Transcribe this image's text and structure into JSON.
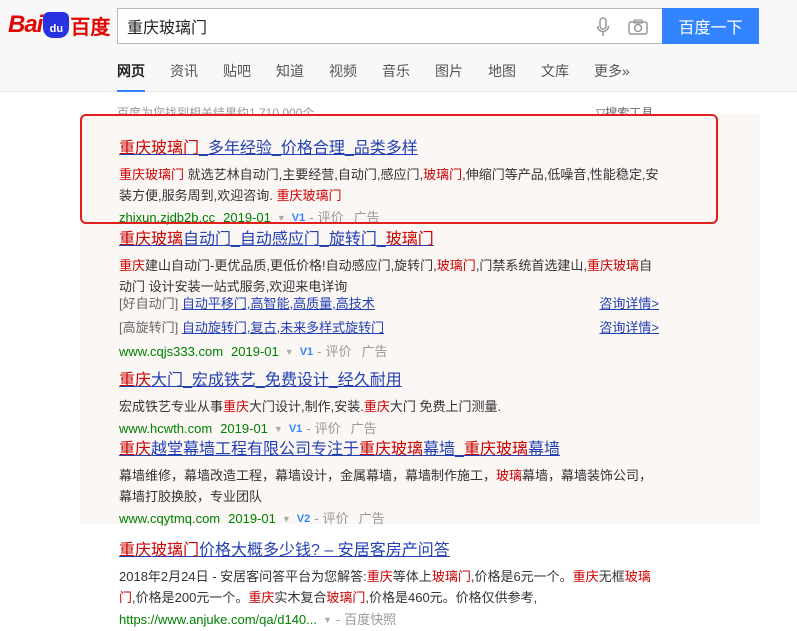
{
  "logo": {
    "bai": "Bai",
    "du": "du",
    "cn": "百度"
  },
  "search": {
    "query": "重庆玻璃门",
    "button": "百度一下"
  },
  "tabs": [
    "网页",
    "资讯",
    "贴吧",
    "知道",
    "视频",
    "音乐",
    "图片",
    "地图",
    "文库",
    "更多»"
  ],
  "result_count": "百度为您找到相关结果约1,710,000个",
  "tools": "搜索工具",
  "results": [
    {
      "title_parts": [
        "重庆玻璃门",
        "_多年经验_价格合理_品类多样"
      ],
      "desc_parts": [
        "重庆玻璃门",
        " 就选艺林自动门,主要经营,自动门,感应门,",
        "玻璃门",
        ",伸缩门等产品,低噪音,性能稳定,安装方便,服务周到,欢迎咨询. ",
        "重庆玻璃门"
      ],
      "url": "zhixun.zjdb2b.cc",
      "date": "2019-01",
      "badge": "V1",
      "eval": "评价",
      "ad": "广告"
    },
    {
      "title_parts": [
        "重庆玻璃",
        "自动门_自动感应门_旋转门_",
        "玻璃门"
      ],
      "desc_parts": [
        "重庆",
        "建山自动门-更优品质,更低价格!自动感应门,旋转门,",
        "玻璃门",
        ",门禁系统首选建山,",
        "重庆玻璃",
        "自动门 设计安装一站式服务,欢迎来电详询"
      ],
      "sub": [
        {
          "cat": "[好自动门]",
          "links": "自动平移门,高智能,高质量,高技术",
          "detail": "咨询详情>"
        },
        {
          "cat": "[高旋转门]",
          "links": "自动旋转门,复古,未来多样式旋转门",
          "detail": "咨询详情>"
        }
      ],
      "url": "www.cqjs333.com",
      "date": "2019-01",
      "badge": "V1",
      "eval": "评价",
      "ad": "广告"
    },
    {
      "title_parts": [
        "重庆",
        "大门_宏成铁艺_免费设计_经久耐用"
      ],
      "desc_parts": [
        "宏成铁艺专业从事",
        "重庆",
        "大门设计,制作,安装.",
        "重庆",
        "大门 免费上门测量."
      ],
      "url": "www.hcwth.com",
      "date": "2019-01",
      "badge": "V1",
      "eval": "评价",
      "ad": "广告"
    },
    {
      "title_parts": [
        "重庆",
        "越堂幕墙工程有限公司专注于",
        "重庆玻璃",
        "幕墙_",
        "重庆玻璃",
        "幕墙"
      ],
      "desc_parts": [
        "幕墙维修，幕墙改造工程，幕墙设计，金属幕墙，幕墙制作施工，",
        "玻璃",
        "幕墙，幕墙装饰公司，幕墙打胶换胶，专业团队"
      ],
      "url": "www.cqytmq.com",
      "date": "2019-01",
      "badge": "V2",
      "eval": "评价",
      "ad": "广告"
    },
    {
      "title_parts": [
        "重庆玻璃门",
        "价格大概多少钱? – 安居客房产问答"
      ],
      "desc_parts": [
        "2018年2月24日 - 安居客问答平台为您解答:",
        "重庆",
        "等体上",
        "玻璃门",
        ",价格是6元一个。",
        "重庆",
        "无框",
        "玻璃门",
        ",价格是200元一个。",
        "重庆",
        "实木复合",
        "玻璃门",
        ",价格是460元。价格仅供参考,"
      ],
      "url": "https://www.anjuke.com/qa/d140...",
      "snapshot": "百度快照"
    }
  ],
  "colors": {
    "link": "#2440b3",
    "highlight_red": "#c00",
    "url_green": "#008000",
    "button_blue": "#3385ff",
    "annotation_box": "#e0201b"
  }
}
